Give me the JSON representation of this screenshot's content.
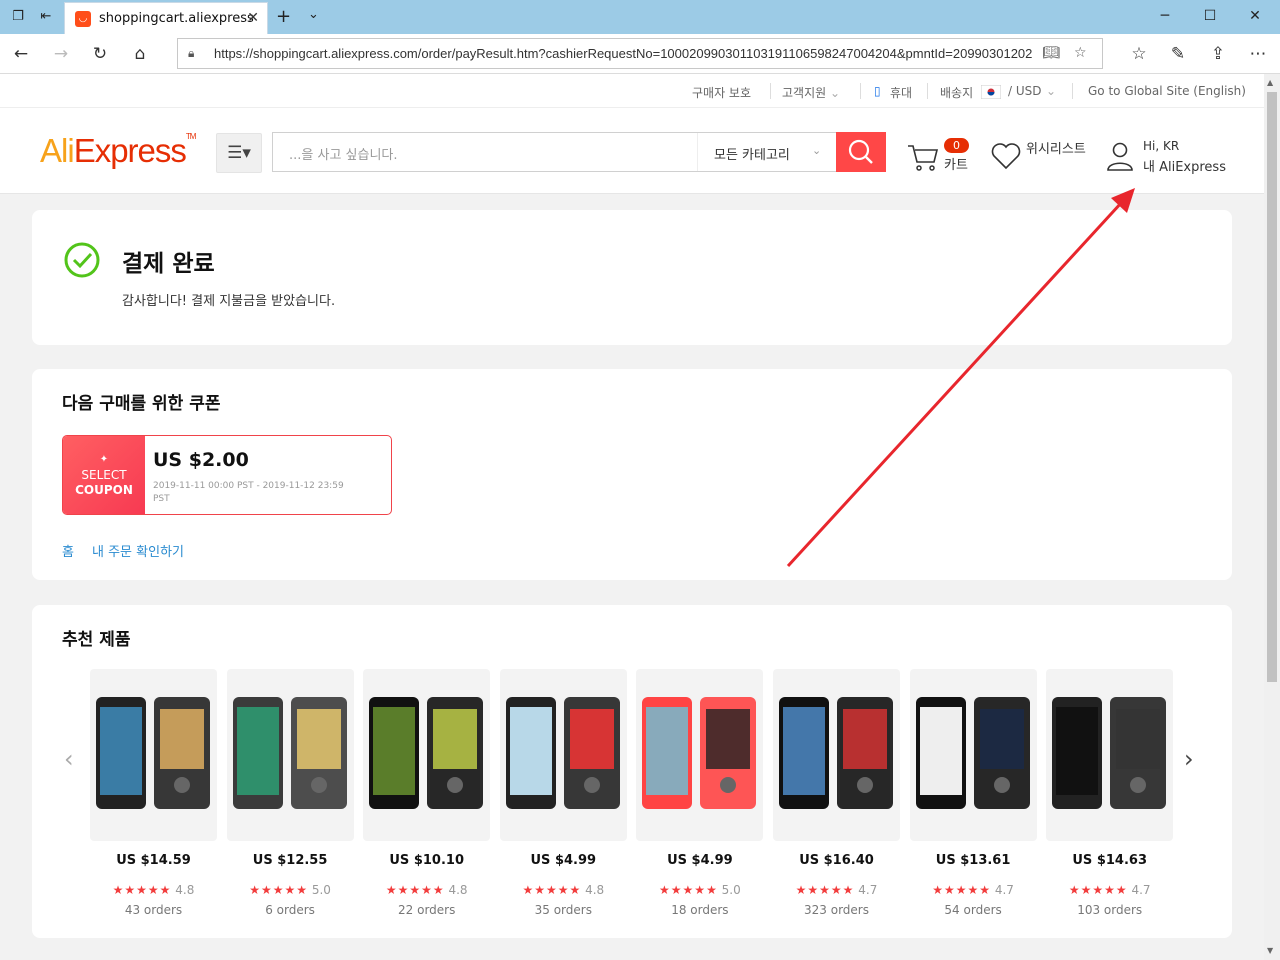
{
  "browser": {
    "tab_title": "shoppingcart.aliexpress",
    "url": "https://shoppingcart.aliexpress.com/order/payResult.htm?cashierRequestNo=10002099030110319110659824700420​4&pmntId=20990301202"
  },
  "topbar": {
    "buyer_protection": "구매자 보호",
    "customer_service": "고객지원",
    "mobile": "휴대",
    "ship_to": "배송지",
    "currency": "/ USD",
    "global_site": "Go to Global Site (English)"
  },
  "header": {
    "logo_ali": "Ali",
    "logo_express": "Express",
    "logo_tm": "TM",
    "search_placeholder": "...을 사고 싶습니다.",
    "category": "모든 카테고리",
    "cart_count": "0",
    "cart_label": "카트",
    "wishlist_label": "위시리스트",
    "greeting": "Hi, KR",
    "my_account": "내 AliExpress"
  },
  "payment": {
    "title": "결제 완료",
    "subtitle": "감사합니다! 결제 지불금을 받았습니다."
  },
  "coupon_section": {
    "title": "다음 구매를 위한 쿠폰",
    "badge_star": "✦",
    "badge_line1": "SELECT",
    "badge_line2": "COUPON",
    "amount": "US $2.00",
    "validity": "2019-11-11 00:00 PST - 2019-11-12 23:59 PST",
    "link_home": "홈",
    "link_orders": "내 주문 확인하기"
  },
  "recommended": {
    "title": "추천 제품",
    "products": [
      {
        "price": "US $14.59",
        "rating": "4.8",
        "orders": "43 orders",
        "stars": "★★★★★"
      },
      {
        "price": "US $12.55",
        "rating": "5.0",
        "orders": "6 orders",
        "stars": "★★★★★"
      },
      {
        "price": "US $10.10",
        "rating": "4.8",
        "orders": "22 orders",
        "stars": "★★★★★"
      },
      {
        "price": "US $4.99",
        "rating": "4.8",
        "orders": "35 orders",
        "stars": "★★★★★"
      },
      {
        "price": "US $4.99",
        "rating": "5.0",
        "orders": "18 orders",
        "stars": "★★★★★"
      },
      {
        "price": "US $16.40",
        "rating": "4.7",
        "orders": "323 orders",
        "stars": "★★★★★"
      },
      {
        "price": "US $13.61",
        "rating": "4.7",
        "orders": "54 orders",
        "stars": "★★★★★"
      },
      {
        "price": "US $14.63",
        "rating": "4.7",
        "orders": "103 orders",
        "stars": "★★★★★"
      }
    ]
  },
  "colors": {
    "accent_red": "#ff4747",
    "logo_orange": "#f7a21b",
    "logo_red": "#e62e04",
    "link_blue": "#2a8bd0",
    "success_green": "#52c41a",
    "annotation_arrow": "#e8262d"
  }
}
